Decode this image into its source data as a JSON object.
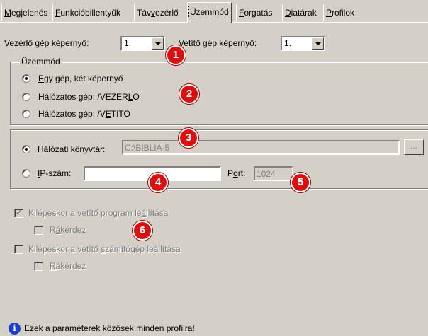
{
  "tabs": [
    {
      "pre": "",
      "u": "M",
      "post": "egjelenés"
    },
    {
      "pre": "",
      "u": "F",
      "post": "unkcióbillentyűk"
    },
    {
      "pre": "Táv",
      "u": "v",
      "post": "ezérlő"
    },
    {
      "pre": "",
      "u": "Ü",
      "post": "zemmód"
    },
    {
      "pre": "",
      "u": "F",
      "post": "orgatás"
    },
    {
      "pre": "",
      "u": "D",
      "post": "iatárak"
    },
    {
      "pre": "",
      "u": "P",
      "post": "rofilok"
    }
  ],
  "screens": {
    "control_label_pre": "Vezérlő gép képer",
    "control_label_u": "n",
    "control_label_post": "yő:",
    "control_value": "1.",
    "projector_label_pre": "",
    "projector_label_u": "V",
    "projector_label_post": "etítő gép képernyő:",
    "projector_label_pre2": "",
    "projector_label_u2": "n",
    "projector_value": "1."
  },
  "mode_group": {
    "title": "Üzemmód",
    "options": [
      {
        "pre": "",
        "u": "E",
        "post": "gy gép, két képernyő",
        "checked": true
      },
      {
        "pre": "Hálózatos gép: /VEZER",
        "u": "L",
        "post": "O",
        "checked": false
      },
      {
        "pre": "Hálózatos gép: /V",
        "u": "E",
        "post": "TITO",
        "checked": false
      }
    ]
  },
  "network": {
    "library_label_pre": "",
    "library_label_u": "H",
    "library_label_post": "álózati könyvtár:",
    "library_value": "C:\\BIBLIA-5",
    "browse_label": "...",
    "ip_label_pre": "",
    "ip_label_u": "I",
    "ip_label_post": "P-szám:",
    "ip_value": "",
    "port_label_pre": "P",
    "port_label_u": "o",
    "port_label_post": "rt:",
    "port_value": "1024"
  },
  "exit_options": {
    "stop_program": {
      "pre": "Kilépéskor a vetítő program le",
      "u": "á",
      "post": "llítása",
      "checked": true
    },
    "ask1": {
      "pre": "R",
      "u": "á",
      "post": "kérdez",
      "checked": false
    },
    "stop_computer": {
      "pre": "Kilépéskor a vetítő ",
      "u": "s",
      "post": "zámítógép leállítása",
      "checked": false
    },
    "ask2": {
      "pre": "",
      "u": "R",
      "post": "ákérdez",
      "checked": false
    }
  },
  "markers": [
    "1",
    "2",
    "3",
    "4",
    "5",
    "6"
  ],
  "footer": {
    "icon": "info-icon",
    "text": "Ezek a paraméterek közösek minden profilra!"
  },
  "colors": {
    "marker": "#d81010",
    "info": "#1c3fcf",
    "background": "#d4d0c8"
  }
}
